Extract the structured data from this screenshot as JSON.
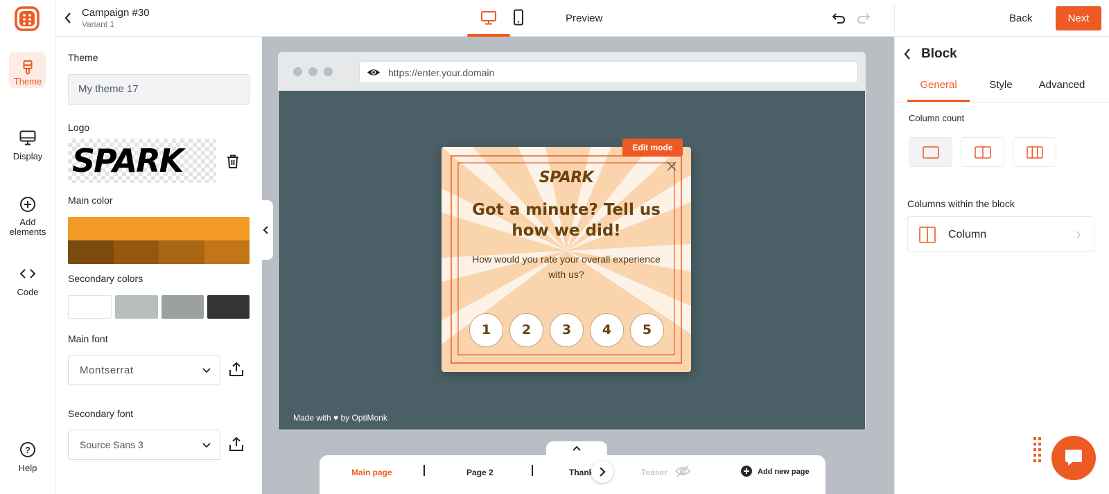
{
  "colors": {
    "accent": "#ee5a24",
    "popup_bg": "#f9d4ad",
    "popup_text": "#6a4210",
    "canvas_bg": "#4a5f66"
  },
  "rail": {
    "items": [
      {
        "label": "Theme",
        "icon": "brush-icon"
      },
      {
        "label": "Display",
        "icon": "monitor-icon"
      },
      {
        "label": "Add elements",
        "icon": "plus-circle-icon"
      },
      {
        "label": "Code",
        "icon": "code-icon"
      },
      {
        "label": "Help",
        "icon": "help-icon"
      }
    ]
  },
  "header": {
    "campaign": "Campaign #30",
    "variant": "Variant 1",
    "preview": "Preview",
    "back": "Back",
    "next": "Next"
  },
  "theme_panel": {
    "theme_label": "Theme",
    "theme_value": "My theme 17",
    "logo_label": "Logo",
    "logo_text": "SPARK",
    "main_color_label": "Main color",
    "main_color": "#f29a23",
    "main_shades": [
      "#7a4a0f",
      "#93570e",
      "#a86512",
      "#c27619"
    ],
    "secondary_label": "Secondary colors",
    "secondary_colors": [
      "#ffffff",
      "#b8bfbb",
      "#9ba19e",
      "#333435"
    ],
    "main_font_label": "Main font",
    "main_font_value": "Montserrat",
    "secondary_font_label": "Secondary font",
    "secondary_font_value": "Source Sans 3"
  },
  "browser": {
    "url": "https://enter.your.domain"
  },
  "popup": {
    "edit_mode": "Edit mode",
    "logo": "SPARK",
    "headline": "Got a minute? Tell us how we did!",
    "question": "How would you rate your overall experience with us?",
    "ratings": [
      "1",
      "2",
      "3",
      "4",
      "5"
    ],
    "made_with": "Made with ♥ by OptiMonk"
  },
  "pages": {
    "main": "Main page",
    "page2": "Page 2",
    "thank": "Thank",
    "teaser": "Teaser",
    "add": "Add new page"
  },
  "right_panel": {
    "title": "Block",
    "tabs": [
      "General",
      "Style",
      "Advanced"
    ],
    "column_count_label": "Column count",
    "columns_within_label": "Columns within the block",
    "column_item": "Column"
  }
}
